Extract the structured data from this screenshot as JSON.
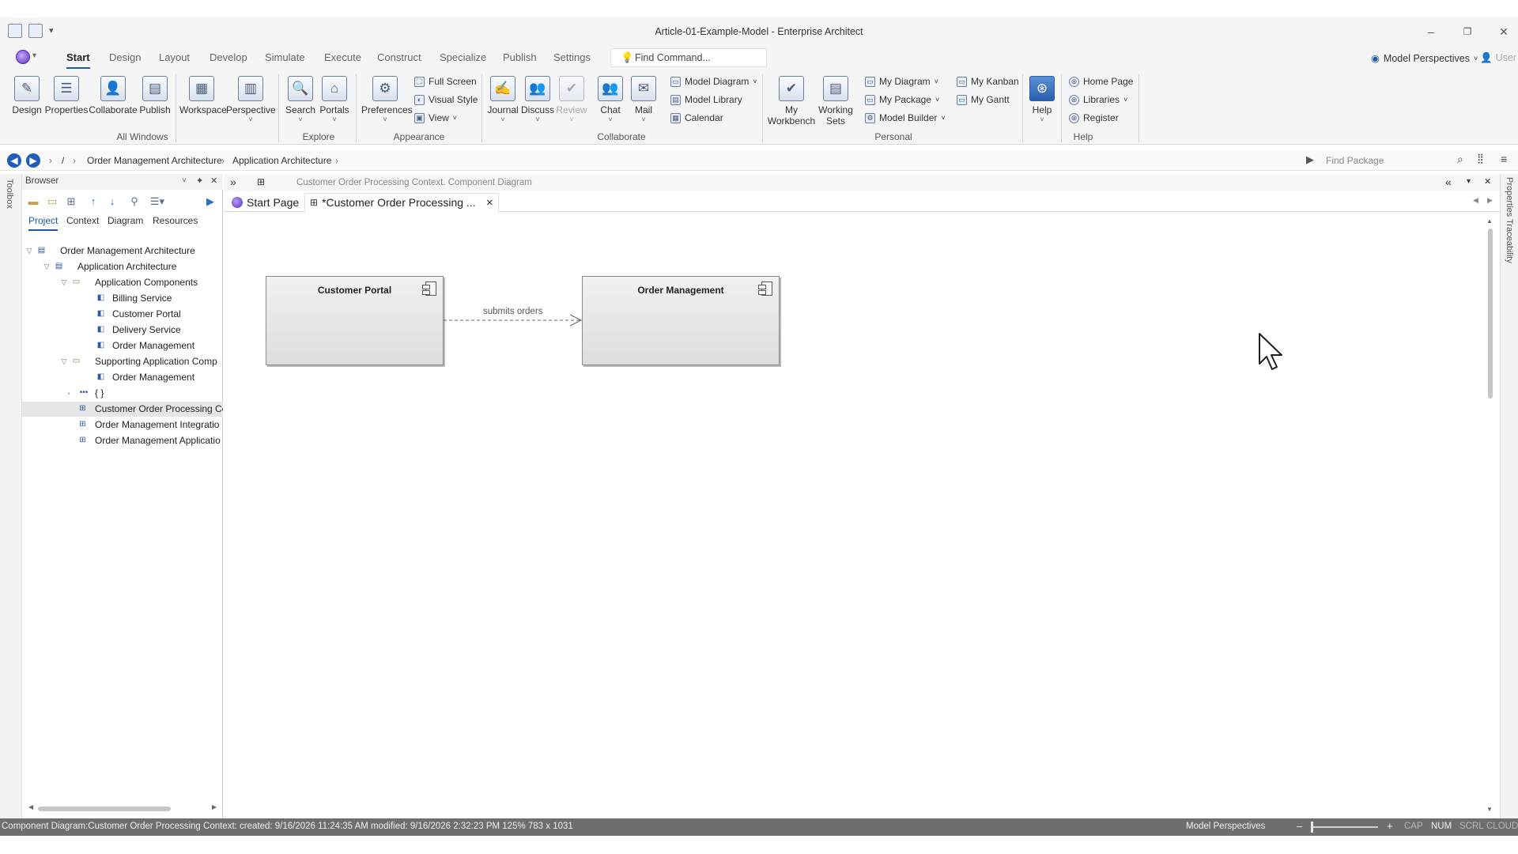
{
  "window": {
    "title": "Article-01-Example-Model - Enterprise Architect",
    "minimize": "–",
    "restore": "❐",
    "close": "✕"
  },
  "menu": {
    "tabs": [
      "Start",
      "Design",
      "Layout",
      "Develop",
      "Simulate",
      "Execute",
      "Construct",
      "Specialize",
      "Publish",
      "Settings"
    ],
    "find_command": "Find Command...",
    "model_perspectives": "Model Perspectives",
    "user": "User"
  },
  "ribbon": {
    "all_windows": {
      "label": "All Windows",
      "design": "Design",
      "properties": "Properties",
      "collaborate": "Collaborate",
      "publish": "Publish"
    },
    "workspace": "Workspace",
    "perspective": "Perspective",
    "explore": {
      "label": "Explore",
      "search": "Search",
      "portals": "Portals"
    },
    "appearance": {
      "label": "Appearance",
      "preferences": "Preferences",
      "full_screen": "Full Screen",
      "visual_style": "Visual Style",
      "view": "View"
    },
    "collaborate": {
      "label": "Collaborate",
      "journal": "Journal",
      "discuss": "Discuss",
      "review": "Review",
      "chat": "Chat",
      "mail": "Mail",
      "model_diagram": "Model Diagram",
      "model_library": "Model Library",
      "calendar": "Calendar"
    },
    "personal": {
      "label": "Personal",
      "my_workbench_1": "My",
      "my_workbench_2": "Workbench",
      "working_sets_1": "Working",
      "working_sets_2": "Sets",
      "my_diagram": "My Diagram",
      "my_package": "My Package",
      "model_builder": "Model Builder",
      "my_kanban": "My Kanban",
      "my_gantt": "My Gantt"
    },
    "help": {
      "label": "Help",
      "help": "Help",
      "home_page": "Home Page",
      "libraries": "Libraries",
      "register": "Register"
    }
  },
  "nav": {
    "root": "/",
    "crumbs": [
      "Order Management Architecture",
      "Application Architecture"
    ],
    "find_package": "Find Package"
  },
  "toolbox": {
    "label": "Toolbox"
  },
  "browser": {
    "title": "Browser",
    "tabs": [
      "Project",
      "Context",
      "Diagram",
      "Resources"
    ],
    "tree": [
      {
        "label": "Order Management Architecture"
      },
      {
        "label": "Application Architecture"
      },
      {
        "label": "Application Components"
      },
      {
        "label": "Billing Service"
      },
      {
        "label": "Customer Portal"
      },
      {
        "label": "Delivery Service"
      },
      {
        "label": "Order Management"
      },
      {
        "label": "Supporting Application Comp"
      },
      {
        "label": "Order Management"
      },
      {
        "label": "{ }"
      },
      {
        "label": "Customer Order Processing Co"
      },
      {
        "label": "Order Management Integratio"
      },
      {
        "label": "Order Management Applicatio"
      }
    ]
  },
  "document": {
    "header": "Customer Order Processing Context.  Component Diagram",
    "tabs": [
      "Start Page",
      "*Customer Order Processing ..."
    ]
  },
  "diagram": {
    "components": [
      "Customer Portal",
      "Order Management"
    ],
    "connector_label": "submits orders"
  },
  "right_panel": {
    "label": "Properties  Traceability"
  },
  "status": {
    "info": "Component Diagram:Customer Order Processing Context:  created: 9/16/2026 11:24:35 AM  modified: 9/16/2026 2:32:23 PM   125%   783 x 1031",
    "perspectives": "Model Perspectives",
    "minus": "–",
    "plus": "+",
    "cap": "CAP",
    "num": "NUM",
    "scrl": "SCRL",
    "cloud": "CLOUD"
  }
}
